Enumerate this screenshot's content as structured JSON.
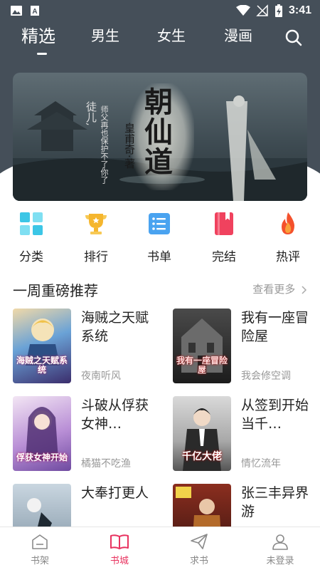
{
  "status_bar": {
    "time": "3:41"
  },
  "top_tabs": [
    "精选",
    "男生",
    "女生",
    "漫画"
  ],
  "banner": {
    "title": "朝仙道",
    "author": "皇甫奇·著",
    "quote_lines": [
      "师父再也保护不了你了",
      "徒儿,"
    ]
  },
  "categories": [
    {
      "label": "分类",
      "icon": "grid-icon",
      "color": "#3cc6e6"
    },
    {
      "label": "排行",
      "icon": "trophy-icon",
      "color": "#f5b62e"
    },
    {
      "label": "书单",
      "icon": "list-icon",
      "color": "#4aa3f0"
    },
    {
      "label": "完结",
      "icon": "book-icon",
      "color": "#f0425e"
    },
    {
      "label": "热评",
      "icon": "flame-icon",
      "color": "#f4512c"
    }
  ],
  "section": {
    "title": "一周重磅推荐",
    "more": "查看更多"
  },
  "books": [
    {
      "title": "海贼之天赋系统",
      "author": "夜南听风",
      "cover_text": "海贼之天赋系统"
    },
    {
      "title": "我有一座冒险屋",
      "author": "我会修空调",
      "cover_text": "我有一座冒险屋"
    },
    {
      "title": "斗破从俘获女神…",
      "author": "橘猫不吃渔",
      "cover_text": "俘获女神开始"
    },
    {
      "title": "从签到开始当千…",
      "author": "情忆流年",
      "cover_text": "千亿大佬"
    },
    {
      "title": "大奉打更人",
      "author": "",
      "cover_text": ""
    },
    {
      "title": "张三丰异界游",
      "author": "",
      "cover_text": ""
    }
  ],
  "bottom_nav": [
    "书架",
    "书城",
    "求书",
    "未登录"
  ],
  "colors": {
    "accent": "#e8325f",
    "header": "#454f59"
  }
}
